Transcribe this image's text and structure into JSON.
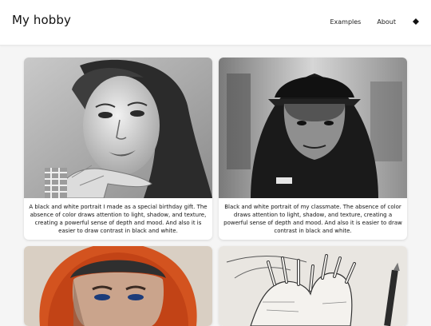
{
  "header": {
    "title": "My hobby",
    "nav": [
      {
        "label": "Examples"
      },
      {
        "label": "About"
      }
    ],
    "theme_icon": "diamond-icon"
  },
  "cards": [
    {
      "caption": "A black and white portrait I made as a special birthday gift. The absence of color draws attention to light, shadow, and texture, creating a powerful sense of depth and mood. And also it is easier to draw contrast in black and white.",
      "image": "portrait-girl-hand-icon"
    },
    {
      "caption": "Black and white portrait of my classmate. The absence of color draws attention to light, shadow, and texture, creating a powerful sense of depth and mood. And also it is easier to draw contrast in black and white.",
      "image": "portrait-hooded-man-icon"
    },
    {
      "caption": "",
      "image": "portrait-red-hood-icon"
    },
    {
      "caption": "",
      "image": "hands-sketch-icon"
    }
  ]
}
